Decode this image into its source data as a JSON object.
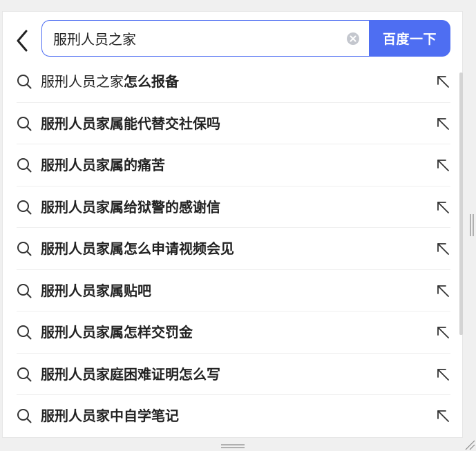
{
  "search": {
    "query": "服刑人员之家",
    "submit_label": "百度一下"
  },
  "icons": {
    "back": "chevron-left-icon",
    "clear": "clear-circle-icon",
    "suggest": "search-icon",
    "fill": "arrow-up-left-icon"
  },
  "colors": {
    "accent": "#4e6ef2",
    "text": "#222222",
    "divider": "#eeeeee"
  },
  "suggestions": [
    {
      "plain": "服刑人员之家",
      "bold": "怎么报备"
    },
    {
      "plain": "",
      "bold": "服刑人员家属能代替交社保吗"
    },
    {
      "plain": "",
      "bold": "服刑人员家属的痛苦"
    },
    {
      "plain": "",
      "bold": "服刑人员家属给狱警的感谢信"
    },
    {
      "plain": "",
      "bold": "服刑人员家属怎么申请视频会见"
    },
    {
      "plain": "",
      "bold": "服刑人员家属贴吧"
    },
    {
      "plain": "",
      "bold": "服刑人员家属怎样交罚金"
    },
    {
      "plain": "",
      "bold": "服刑人员家庭困难证明怎么写"
    },
    {
      "plain": "",
      "bold": "服刑人员家中自学笔记"
    }
  ]
}
